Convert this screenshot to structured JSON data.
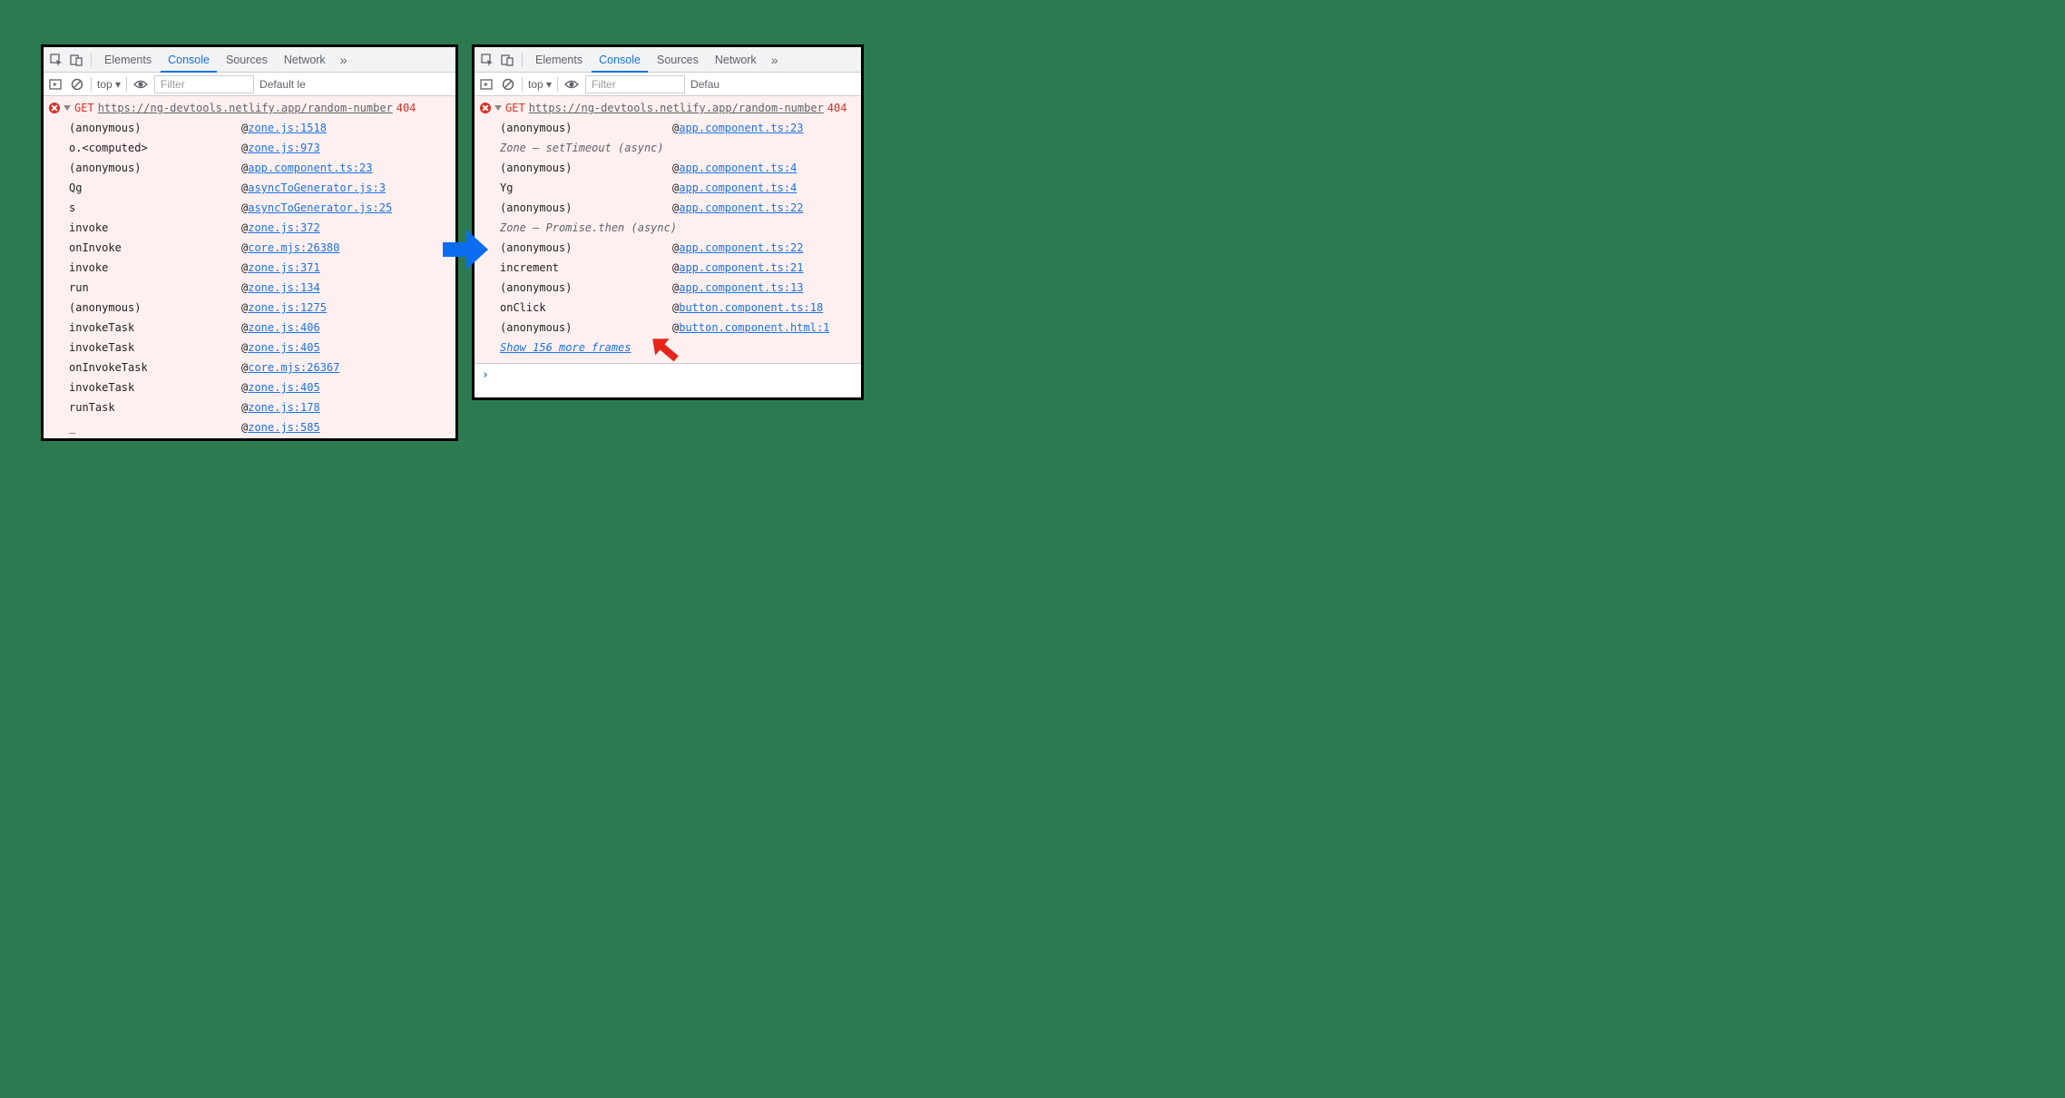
{
  "tabs": {
    "elements": "Elements",
    "console": "Console",
    "sources": "Sources",
    "network": "Network"
  },
  "toolbar": {
    "ctx": "top ▾",
    "filter_placeholder": "Filter",
    "levels_left": "Default le",
    "levels_right": "Defau"
  },
  "error": {
    "method": "GET",
    "url": "https://ng-devtools.netlify.app/random-number",
    "status": "404"
  },
  "left_trace": [
    {
      "fn": "(anonymous)",
      "loc": "zone.js:1518"
    },
    {
      "fn": "o.<computed>",
      "loc": "zone.js:973"
    },
    {
      "fn": "(anonymous)",
      "loc": "app.component.ts:23"
    },
    {
      "fn": "Qg",
      "loc": "asyncToGenerator.js:3"
    },
    {
      "fn": "s",
      "loc": "asyncToGenerator.js:25"
    },
    {
      "fn": "invoke",
      "loc": "zone.js:372"
    },
    {
      "fn": "onInvoke",
      "loc": "core.mjs:26380"
    },
    {
      "fn": "invoke",
      "loc": "zone.js:371"
    },
    {
      "fn": "run",
      "loc": "zone.js:134"
    },
    {
      "fn": "(anonymous)",
      "loc": "zone.js:1275"
    },
    {
      "fn": "invokeTask",
      "loc": "zone.js:406"
    },
    {
      "fn": "invokeTask",
      "loc": "zone.js:405"
    },
    {
      "fn": "onInvokeTask",
      "loc": "core.mjs:26367"
    },
    {
      "fn": "invokeTask",
      "loc": "zone.js:405"
    },
    {
      "fn": "runTask",
      "loc": "zone.js:178"
    },
    {
      "fn": "_",
      "loc": "zone.js:585"
    }
  ],
  "right_trace": [
    {
      "type": "frame",
      "fn": "(anonymous)",
      "loc": "app.component.ts:23"
    },
    {
      "type": "async",
      "label": "Zone – setTimeout (async)"
    },
    {
      "type": "frame",
      "fn": "(anonymous)",
      "loc": "app.component.ts:4"
    },
    {
      "type": "frame",
      "fn": "Yg",
      "loc": "app.component.ts:4"
    },
    {
      "type": "frame",
      "fn": "(anonymous)",
      "loc": "app.component.ts:22"
    },
    {
      "type": "async",
      "label": "Zone – Promise.then (async)"
    },
    {
      "type": "frame",
      "fn": "(anonymous)",
      "loc": "app.component.ts:22"
    },
    {
      "type": "frame",
      "fn": "increment",
      "loc": "app.component.ts:21"
    },
    {
      "type": "frame",
      "fn": "(anonymous)",
      "loc": "app.component.ts:13"
    },
    {
      "type": "frame",
      "fn": "onClick",
      "loc": "button.component.ts:18"
    },
    {
      "type": "frame",
      "fn": "(anonymous)",
      "loc": "button.component.html:1"
    }
  ],
  "show_more": "Show 156 more frames"
}
